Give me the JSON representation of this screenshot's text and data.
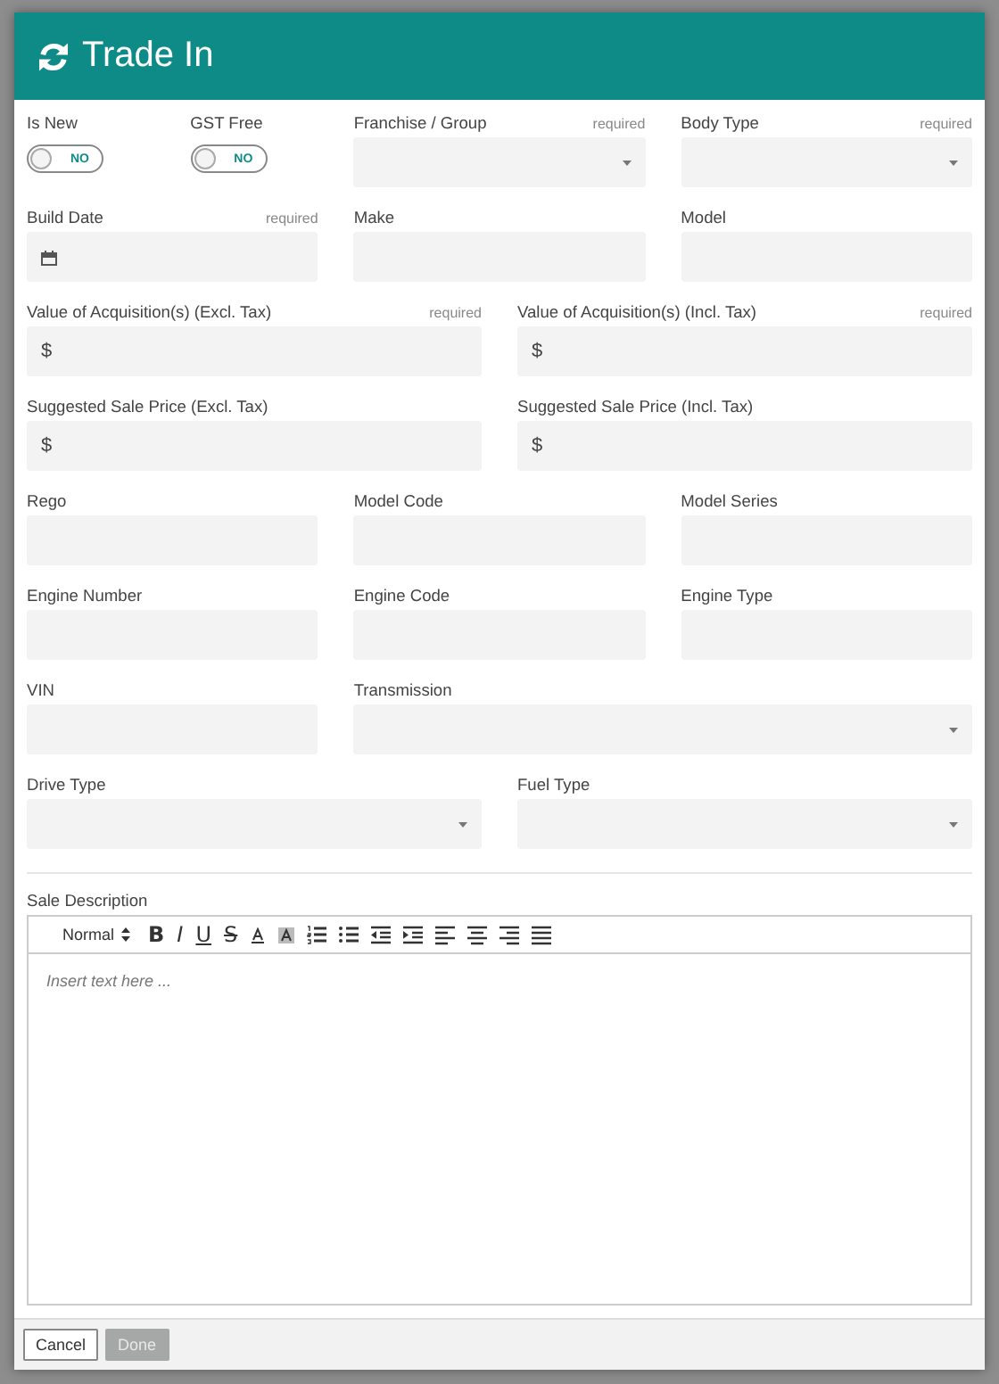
{
  "dialog": {
    "title": "Trade In"
  },
  "rows": [
    [
      {
        "kind": "toggle",
        "label": "Is New",
        "on": false,
        "state_text": "NO"
      },
      {
        "kind": "toggle",
        "label": "GST Free",
        "on": false,
        "state_text": "NO"
      },
      {
        "kind": "select",
        "label": "Franchise / Group",
        "required_text": "required"
      },
      {
        "kind": "select",
        "label": "Body Type",
        "required_text": "required"
      }
    ],
    [
      {
        "kind": "date",
        "label": "Build Date",
        "required_text": "required"
      },
      {
        "kind": "text",
        "label": "Make"
      },
      {
        "kind": "text",
        "label": "Model"
      }
    ],
    [
      {
        "kind": "currency",
        "label": "Value of Acquisition(s) (Excl. Tax)",
        "required_text": "required",
        "prefix": "$"
      },
      {
        "kind": "currency",
        "label": "Value of Acquisition(s) (Incl. Tax)",
        "required_text": "required",
        "prefix": "$"
      }
    ],
    [
      {
        "kind": "currency",
        "label": "Suggested Sale Price (Excl. Tax)",
        "prefix": "$"
      },
      {
        "kind": "currency",
        "label": "Suggested Sale Price (Incl. Tax)",
        "prefix": "$"
      }
    ],
    [
      {
        "kind": "text",
        "label": "Rego"
      },
      {
        "kind": "text",
        "label": "Model Code"
      },
      {
        "kind": "text",
        "label": "Model Series"
      }
    ],
    [
      {
        "kind": "text",
        "label": "Engine Number"
      },
      {
        "kind": "text",
        "label": "Engine Code"
      },
      {
        "kind": "text",
        "label": "Engine Type"
      }
    ],
    [
      {
        "kind": "text",
        "label": "VIN"
      },
      {
        "kind": "select",
        "label": "Transmission"
      }
    ],
    [
      {
        "kind": "select",
        "label": "Drive Type"
      },
      {
        "kind": "select",
        "label": "Fuel Type"
      }
    ]
  ],
  "description": {
    "label": "Sale Description",
    "style": "Normal",
    "placeholder": "Insert text here ...",
    "toolbar": [
      {
        "kind": "bold",
        "label": "B"
      },
      {
        "kind": "italic",
        "label": "I"
      },
      {
        "kind": "underline",
        "label": "U"
      },
      {
        "kind": "strike",
        "label": "S"
      },
      {
        "kind": "font-color"
      },
      {
        "kind": "background-color"
      },
      {
        "kind": "ordered-list"
      },
      {
        "kind": "bullet-list"
      },
      {
        "kind": "outdent"
      },
      {
        "kind": "indent"
      },
      {
        "kind": "align-left"
      },
      {
        "kind": "align-center"
      },
      {
        "kind": "align-right"
      },
      {
        "kind": "justify"
      }
    ]
  },
  "buttons": [
    {
      "label": "Cancel",
      "disabled": false
    },
    {
      "label": "Done",
      "disabled": true
    }
  ]
}
